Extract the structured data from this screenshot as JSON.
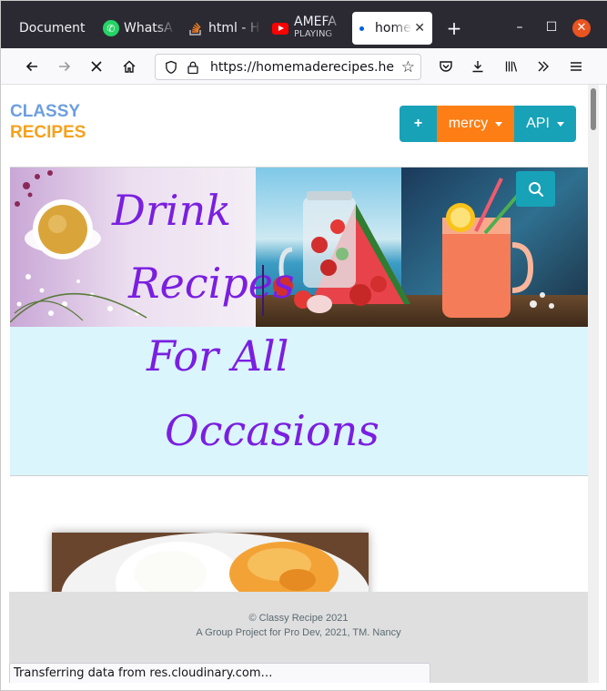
{
  "browser": {
    "tabs": [
      {
        "title": "Document"
      },
      {
        "title": "WhatsA"
      },
      {
        "title": "html - H"
      },
      {
        "title": "AMEFA",
        "subtitle": "PLAYING"
      },
      {
        "title": "home"
      }
    ],
    "new_tab_label": "+",
    "url": {
      "main": "https://homemaderecipes.he",
      "dim": ""
    },
    "window_controls": {
      "minimize": "–",
      "maximize": "☐",
      "close": "✕"
    }
  },
  "site": {
    "brand_line1": "CLASSY",
    "brand_line2": "RECIPES",
    "plus_label": "+",
    "user_menu_label": "mercy",
    "api_menu_label": "API"
  },
  "hero": {
    "lines": [
      "Drink",
      "Recipes",
      "For All",
      "Occasions"
    ]
  },
  "footer": {
    "copyright": "© Classy Recipe 2021",
    "credit": "A Group Project for Pro Dev, 2021, TM. Nancy"
  },
  "status": {
    "text": "Transferring data from res.cloudinary.com…"
  },
  "colors": {
    "brand_blue": "#6d9ee0",
    "brand_orange": "#f5a11c",
    "teal": "#17a2b8",
    "orange_button": "#fd7e14",
    "hero_text": "#7a1fe0",
    "hero_bg": "#dbf5fd"
  }
}
